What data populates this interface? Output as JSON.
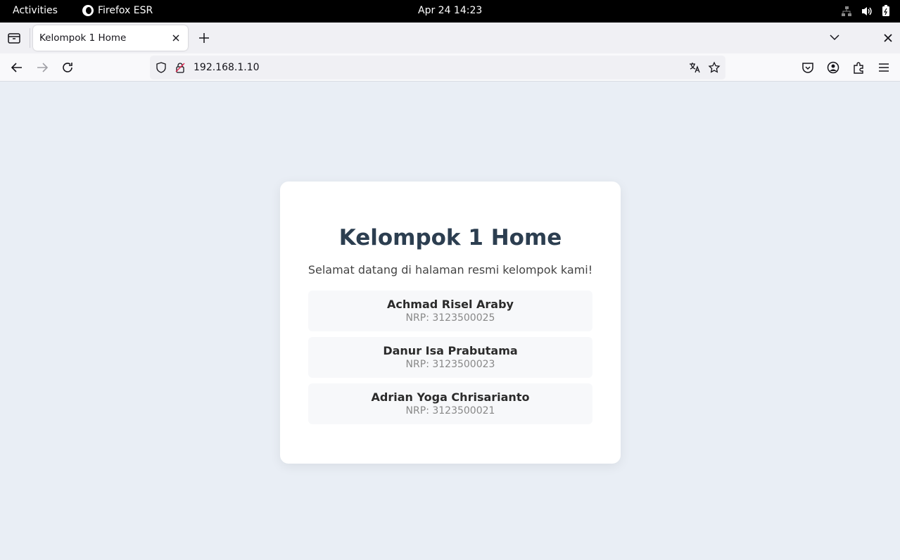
{
  "system_bar": {
    "activities": "Activities",
    "app_name": "Firefox ESR",
    "clock": "Apr 24  14:23",
    "tray_icons": [
      "network-icon",
      "volume-icon",
      "battery-icon"
    ]
  },
  "browser": {
    "tab": {
      "title": "Kelompok 1 Home"
    },
    "url": "192.168.1.10"
  },
  "page": {
    "title": "Kelompok 1 Home",
    "subtitle": "Selamat datang di halaman resmi kelompok kami!",
    "members": [
      {
        "name": "Achmad Risel Araby",
        "nrp": "NRP: 3123500025"
      },
      {
        "name": "Danur Isa Prabutama",
        "nrp": "NRP: 3123500023"
      },
      {
        "name": "Adrian Yoga Chrisarianto",
        "nrp": "NRP: 3123500021"
      }
    ]
  },
  "colors": {
    "page_background": "#e9eef5",
    "card_background": "#ffffff",
    "heading": "#2c3e50",
    "member_background": "#f7f8fa"
  }
}
